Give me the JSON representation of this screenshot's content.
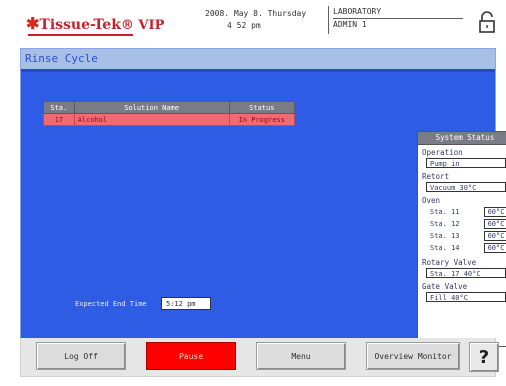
{
  "header": {
    "logo_star": "✱",
    "logo_brand": "Tissue-Tek",
    "logo_vip": "® VIP",
    "logo_reg": "®",
    "date_line": "2008. May 8. Thursday",
    "time_line": "4 52 pm",
    "location": "LABORATORY",
    "user": "ADMIN 1"
  },
  "panel": {
    "title": "Rinse Cycle"
  },
  "table": {
    "columns": [
      "Sta.",
      "Solution Name",
      "Status"
    ],
    "rows": [
      {
        "sta": "17",
        "name": "Alcohol",
        "status": "In Progress"
      }
    ]
  },
  "system_status": {
    "header": "System Status",
    "operation_label": "Operation",
    "operation_value": "Pump in",
    "retort_label": "Retort",
    "retort_value": "Vacuum  30°C",
    "oven_label": "Oven",
    "oven_rows": [
      {
        "label": "Sta. 11",
        "value": "60°C"
      },
      {
        "label": "Sta. 12",
        "value": "60°C"
      },
      {
        "label": "Sta. 13",
        "value": "60°C"
      },
      {
        "label": "Sta. 14",
        "value": "60°C"
      }
    ],
    "rotary_label": "Rotary Valve",
    "rotary_value": "Sta. 17  40°C",
    "gate_label": "Gate Valve",
    "gate_value": "Fill  40°C"
  },
  "end_time": {
    "label": "Expected End Time",
    "value": "5:12 pm"
  },
  "buttons": {
    "logoff": "Log Off",
    "pause": "Pause",
    "menu": "Menu",
    "overview": "Overview Monitor",
    "help": "?"
  },
  "colors": {
    "panel_blue": "#2f5ce5",
    "title_bar": "#a8bfe6",
    "row_highlight": "#f06a72",
    "pause_red": "#ff0000"
  }
}
